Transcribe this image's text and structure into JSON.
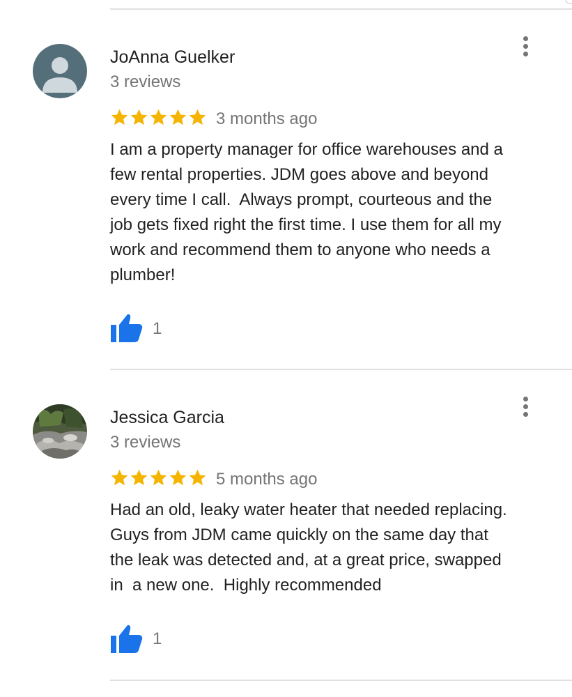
{
  "colors": {
    "star": "#F4B400",
    "like": "#1A73E8",
    "secondary_text": "#757575",
    "divider": "#E0E0E0"
  },
  "reviews": [
    {
      "name": "JoAnna Guelker",
      "review_count": "3 reviews",
      "rating": 5,
      "date": "3 months ago",
      "text": "I am a property manager for office warehouses and a\nfew rental properties. JDM goes above and beyond\nevery time I call.  Always prompt, courteous and the\njob gets fixed right the first time. I use them for all my\nwork and recommend them to anyone who needs a\nplumber!",
      "likes": "1",
      "avatar_icon": "default-person-avatar-icon"
    },
    {
      "name": "Jessica Garcia",
      "review_count": "3 reviews",
      "rating": 5,
      "date": "5 months ago",
      "text": "Had an old, leaky water heater that needed replacing.\nGuys from JDM came quickly on the same day that\nthe leak was detected and, at a great price, swapped\nin  a new one.  Highly recommended",
      "likes": "1",
      "avatar_icon": "photo-avatar-icon"
    }
  ],
  "icons": {
    "menu": "more-vert-icon",
    "like": "thumb-up-icon",
    "star": "star-icon"
  }
}
